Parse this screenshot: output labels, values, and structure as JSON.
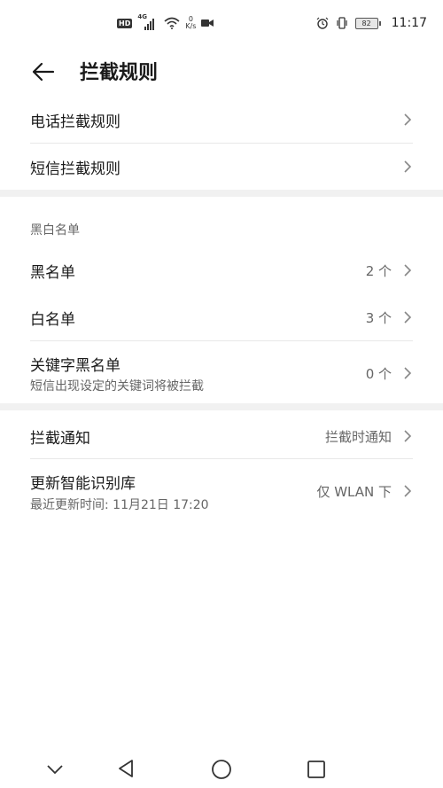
{
  "status_bar": {
    "hd": "HD",
    "network": "4G",
    "speed_value": "0",
    "speed_unit": "K/s",
    "battery": "82",
    "time": "11:17"
  },
  "header": {
    "title": "拦截规则"
  },
  "rules": {
    "call": "电话拦截规则",
    "sms": "短信拦截规则"
  },
  "lists": {
    "section_title": "黑白名单",
    "blacklist": {
      "label": "黑名单",
      "value": "2 个"
    },
    "whitelist": {
      "label": "白名单",
      "value": "3 个"
    },
    "keyword": {
      "label": "关键字黑名单",
      "sub": "短信出现设定的关键词将被拦截",
      "value": "0 个"
    }
  },
  "settings": {
    "notify": {
      "label": "拦截通知",
      "value": "拦截时通知"
    },
    "update": {
      "label": "更新智能识别库",
      "sub": "最近更新时间: 11月21日 17:20",
      "value": "仅 WLAN 下"
    }
  },
  "icons": {
    "back": "back-arrow-icon",
    "chevron": "chevron-right-icon",
    "nav": [
      "collapse-icon",
      "back-triangle-icon",
      "home-circle-icon",
      "recents-square-icon"
    ]
  }
}
